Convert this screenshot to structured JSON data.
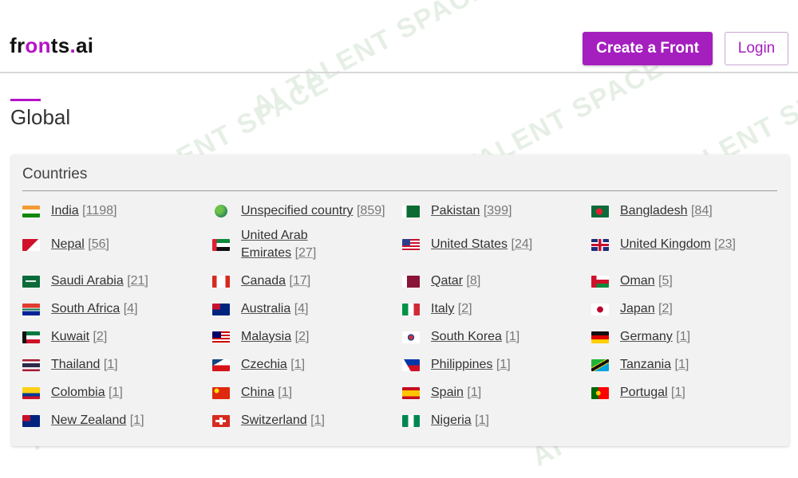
{
  "brand": {
    "prefix": "fr",
    "accent": "on",
    "middle": "ts",
    "dot": ".",
    "suffix": "ai"
  },
  "header": {
    "create_label": "Create a Front",
    "login_label": "Login"
  },
  "page": {
    "title": "Global"
  },
  "watermark": {
    "text": "AI TALENT SPACE"
  },
  "countries": {
    "heading": "Countries",
    "items": [
      {
        "name": "India",
        "count": "[1198]",
        "icon": "flag-india"
      },
      {
        "name": "Unspecified country",
        "count": "[859]",
        "icon": "globe-icon"
      },
      {
        "name": "Pakistan",
        "count": "[399]",
        "icon": "flag-pakistan"
      },
      {
        "name": "Bangladesh",
        "count": "[84]",
        "icon": "flag-bangladesh"
      },
      {
        "name": "Nepal",
        "count": "[56]",
        "icon": "flag-nepal"
      },
      {
        "name": "United Arab Emirates",
        "count": "[27]",
        "icon": "flag-uae"
      },
      {
        "name": "United States",
        "count": "[24]",
        "icon": "flag-usa"
      },
      {
        "name": "United Kingdom",
        "count": "[23]",
        "icon": "flag-uk"
      },
      {
        "name": "Saudi Arabia",
        "count": "[21]",
        "icon": "flag-saudi-arabia"
      },
      {
        "name": "Canada",
        "count": "[17]",
        "icon": "flag-canada"
      },
      {
        "name": "Qatar",
        "count": "[8]",
        "icon": "flag-qatar"
      },
      {
        "name": "Oman",
        "count": "[5]",
        "icon": "flag-oman"
      },
      {
        "name": "South Africa",
        "count": "[4]",
        "icon": "flag-south-africa"
      },
      {
        "name": "Australia",
        "count": "[4]",
        "icon": "flag-australia"
      },
      {
        "name": "Italy",
        "count": "[2]",
        "icon": "flag-italy"
      },
      {
        "name": "Japan",
        "count": "[2]",
        "icon": "flag-japan"
      },
      {
        "name": "Kuwait",
        "count": "[2]",
        "icon": "flag-kuwait"
      },
      {
        "name": "Malaysia",
        "count": "[2]",
        "icon": "flag-malaysia"
      },
      {
        "name": "South Korea",
        "count": "[1]",
        "icon": "flag-south-korea"
      },
      {
        "name": "Germany",
        "count": "[1]",
        "icon": "flag-germany"
      },
      {
        "name": "Thailand",
        "count": "[1]",
        "icon": "flag-thailand"
      },
      {
        "name": "Czechia",
        "count": "[1]",
        "icon": "flag-czechia"
      },
      {
        "name": "Philippines",
        "count": "[1]",
        "icon": "flag-philippines"
      },
      {
        "name": "Tanzania",
        "count": "[1]",
        "icon": "flag-tanzania"
      },
      {
        "name": "Colombia",
        "count": "[1]",
        "icon": "flag-colombia"
      },
      {
        "name": "China",
        "count": "[1]",
        "icon": "flag-china"
      },
      {
        "name": "Spain",
        "count": "[1]",
        "icon": "flag-spain"
      },
      {
        "name": "Portugal",
        "count": "[1]",
        "icon": "flag-portugal"
      },
      {
        "name": "New Zealand",
        "count": "[1]",
        "icon": "flag-new-zealand"
      },
      {
        "name": "Switzerland",
        "count": "[1]",
        "icon": "flag-switzerland"
      },
      {
        "name": "Nigeria",
        "count": "[1]",
        "icon": "flag-nigeria"
      }
    ]
  },
  "colors": {
    "accent": "#b513c8",
    "button": "#a51fbf",
    "card_bg": "#f2f2f2"
  }
}
